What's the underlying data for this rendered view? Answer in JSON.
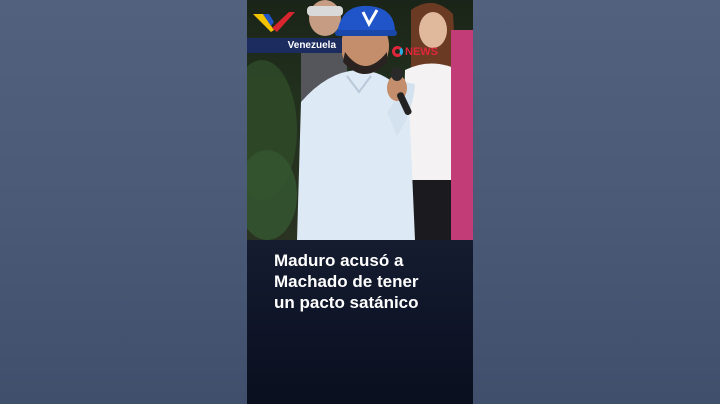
{
  "location_tag": "Venezuela",
  "headline_lines": [
    "Maduro acusó a",
    "Machado de tener",
    "un pacto satánico"
  ],
  "news_logo": {
    "mark": "D",
    "word": "NEWS"
  },
  "colors": {
    "background": "#4a5a78",
    "tag_bg": "#1c2c5e",
    "accent_red": "#d7262e",
    "cap_blue": "#1f55c8"
  },
  "icons": [
    "venezuela-logo-icon",
    "news-logo-icon"
  ]
}
